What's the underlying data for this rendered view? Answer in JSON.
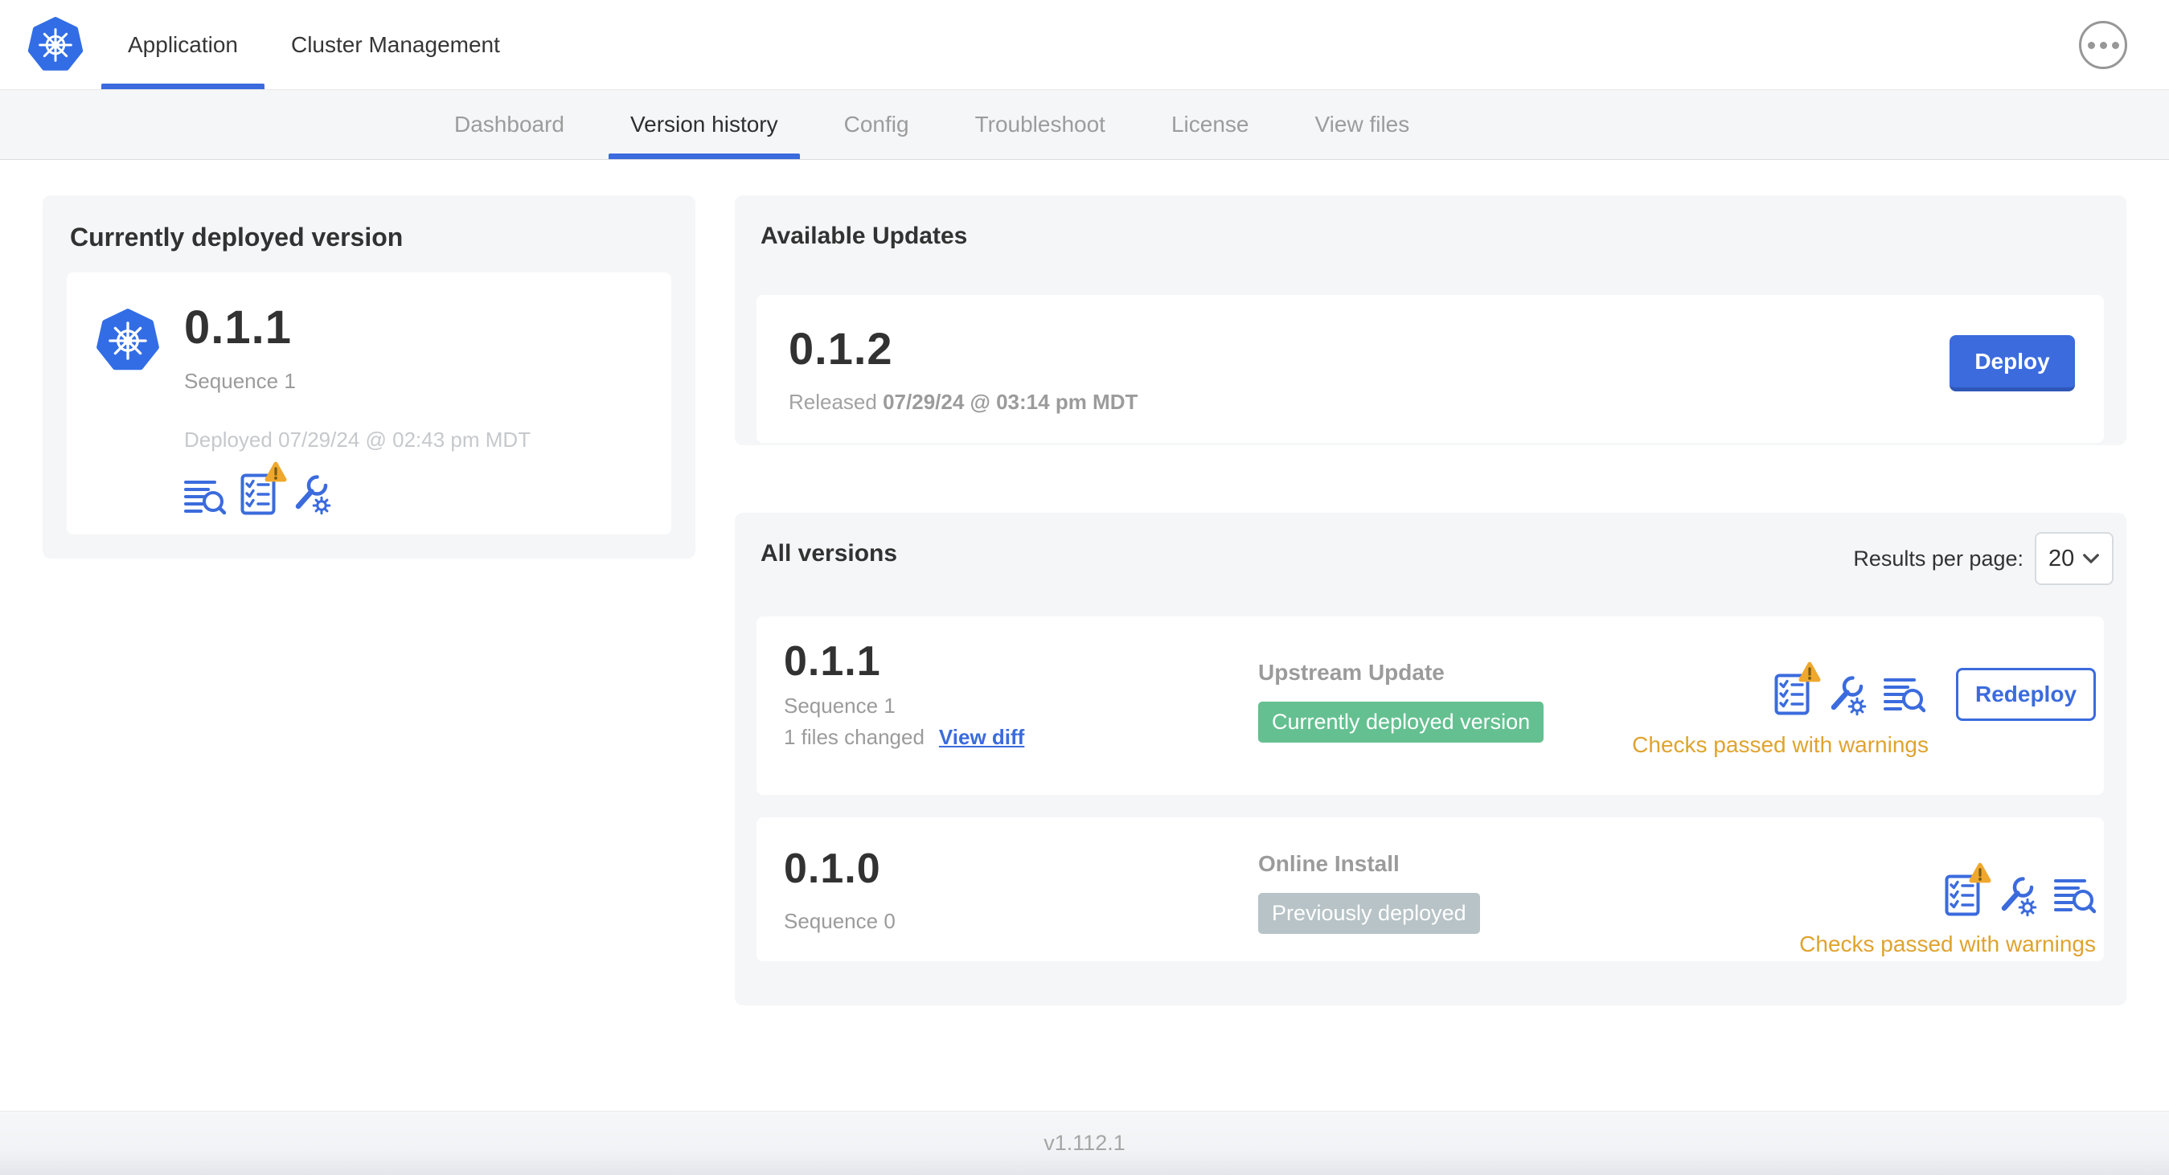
{
  "header": {
    "tabs": [
      {
        "label": "Application"
      },
      {
        "label": "Cluster Management"
      }
    ],
    "active_tab": "Application"
  },
  "subnav": {
    "tabs": [
      {
        "label": "Dashboard"
      },
      {
        "label": "Version history"
      },
      {
        "label": "Config"
      },
      {
        "label": "Troubleshoot"
      },
      {
        "label": "License"
      },
      {
        "label": "View files"
      }
    ],
    "active_tab": "Version history"
  },
  "deployed_card": {
    "title": "Currently deployed version",
    "version": "0.1.1",
    "sequence": "Sequence 1",
    "deployed_at": "Deployed 07/29/24 @ 02:43 pm MDT"
  },
  "available_updates": {
    "title": "Available Updates",
    "version": "0.1.2",
    "released_label": "Released",
    "released_at": "07/29/24 @ 03:14 pm MDT",
    "deploy_label": "Deploy"
  },
  "all_versions": {
    "title": "All versions",
    "results_per_page_label": "Results per page:",
    "results_per_page_value": "20",
    "rows": [
      {
        "version": "0.1.1",
        "sequence": "Sequence 1",
        "files_changed": "1 files changed",
        "view_diff_label": "View diff",
        "source": "Upstream Update",
        "badge": "Currently deployed version",
        "status": "Checks passed with warnings",
        "action_label": "Redeploy"
      },
      {
        "version": "0.1.0",
        "sequence": "Sequence 0",
        "source": "Online Install",
        "badge": "Previously deployed",
        "status": "Checks passed with warnings"
      }
    ]
  },
  "footer": {
    "app_version": "v1.112.1"
  },
  "icons": {
    "logo": "kubernetes-logo",
    "release_notes": "release-notes-icon",
    "preflight": "preflight-checks-icon",
    "preflight_warning": "warning-triangle-icon",
    "config": "config-wrench-gear-icon",
    "more_menu": "ellipsis-icon",
    "select_chevron": "chevron-down-icon"
  },
  "colors": {
    "accent_blue": "#3b6bdd",
    "logo_blue": "#326de6",
    "badge_green": "#64c090",
    "badge_gray": "#b7c3c6",
    "warning_amber": "#dfa32e",
    "card_bg": "#f5f6f8"
  }
}
